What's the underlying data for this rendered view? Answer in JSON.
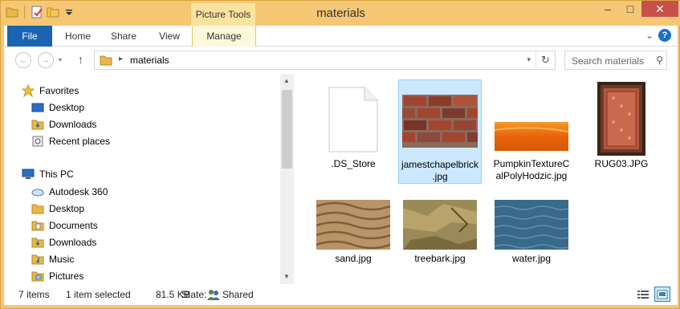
{
  "window": {
    "title": "materials",
    "context_tab": "Picture Tools",
    "controls": [
      "–",
      "□",
      "✕"
    ]
  },
  "ribbon": {
    "tabs": [
      "File",
      "Home",
      "Share",
      "View",
      "Manage"
    ]
  },
  "address": {
    "path": "materials",
    "search_placeholder": "Search materials"
  },
  "navigation": {
    "favorites_label": "Favorites",
    "favorites": [
      "Desktop",
      "Downloads",
      "Recent places"
    ],
    "thispc_label": "This PC",
    "thispc": [
      "Autodesk 360",
      "Desktop",
      "Documents",
      "Downloads",
      "Music",
      "Pictures"
    ]
  },
  "files": [
    {
      "name": ".DS_Store",
      "thumb": "blank-file-icon"
    },
    {
      "name": "jamestchapelbrick.jpg",
      "thumb": "brick-thumb",
      "selected": true
    },
    {
      "name": "PumpkinTextureCalPolyHodzic.jpg",
      "thumb": "pumpkin-thumb"
    },
    {
      "name": "RUG03.JPG",
      "thumb": "rug-thumb"
    },
    {
      "name": "sand.jpg",
      "thumb": "sand-thumb"
    },
    {
      "name": "treebark.jpg",
      "thumb": "treebark-thumb"
    },
    {
      "name": "water.jpg",
      "thumb": "water-thumb"
    }
  ],
  "file_labels": {
    "ds": ".DS_Store",
    "brick": "jamestchapelbrick.jpg",
    "pumpkin": "PumpkinTextureCalPolyHodzic.jpg",
    "rug": "RUG03.JPG",
    "sand": "sand.jpg",
    "bark": "treebark.jpg",
    "water": "water.jpg"
  },
  "status": {
    "items": "7 items",
    "selected": "1 item selected",
    "size": "81.5 KB",
    "state_label": "State:",
    "state_value": "Shared"
  },
  "colors": {
    "title_bar": "#f5c775",
    "file_tab": "#1a64b3",
    "selection": "#cce8ff",
    "close_button": "#c7504a"
  }
}
